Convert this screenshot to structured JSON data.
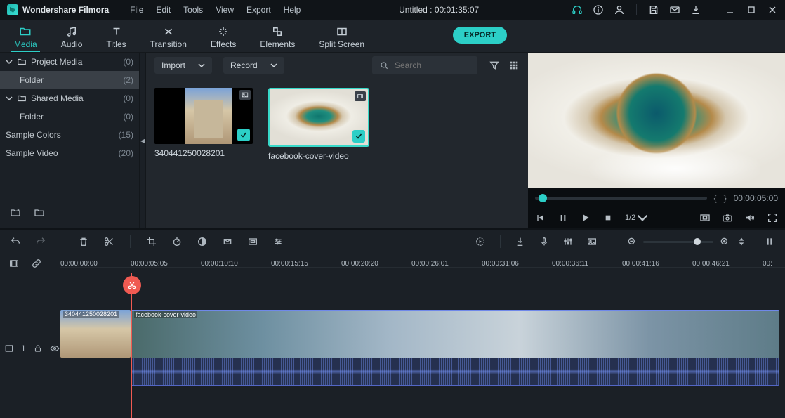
{
  "brand": "Wondershare Filmora",
  "menus": [
    "File",
    "Edit",
    "Tools",
    "View",
    "Export",
    "Help"
  ],
  "title": "Untitled : 00:01:35:07",
  "titlebar_icons": {
    "support": "headphones-icon",
    "info": "info-icon",
    "user": "user-icon",
    "save": "save-icon",
    "mail": "mail-icon",
    "download": "download-icon",
    "minimize": "minimize-icon",
    "maximize": "maximize-icon",
    "close": "close-icon"
  },
  "tabs": [
    {
      "id": "media",
      "label": "Media",
      "icon": "folder-icon",
      "active": true
    },
    {
      "id": "audio",
      "label": "Audio",
      "icon": "music-icon"
    },
    {
      "id": "titles",
      "label": "Titles",
      "icon": "text-icon"
    },
    {
      "id": "transition",
      "label": "Transition",
      "icon": "transition-icon"
    },
    {
      "id": "effects",
      "label": "Effects",
      "icon": "sparkle-icon"
    },
    {
      "id": "elements",
      "label": "Elements",
      "icon": "shapes-icon"
    },
    {
      "id": "split",
      "label": "Split Screen",
      "icon": "split-icon"
    }
  ],
  "export_label": "EXPORT",
  "sidebar": {
    "groups": [
      {
        "label": "Project Media",
        "count": "(0)",
        "expanded": true,
        "sub": [
          {
            "label": "Folder",
            "count": "(2)",
            "selected": true
          }
        ]
      },
      {
        "label": "Shared Media",
        "count": "(0)",
        "expanded": true,
        "sub": [
          {
            "label": "Folder",
            "count": "(0)"
          }
        ]
      }
    ],
    "bottom": [
      {
        "label": "Sample Colors",
        "count": "(15)"
      },
      {
        "label": "Sample Video",
        "count": "(20)"
      }
    ],
    "footer_icons": [
      "new-folder-icon",
      "folder-icon"
    ]
  },
  "media_toolbar": {
    "import": "Import",
    "record": "Record",
    "search_placeholder": "Search",
    "right_icons": [
      "filter-icon",
      "grid-icon"
    ]
  },
  "media_items": [
    {
      "caption": "340441250028201",
      "thumb": "street",
      "type": "image",
      "checked": true,
      "selected": false
    },
    {
      "caption": "facebook-cover-video",
      "thumb": "aerial",
      "type": "video",
      "checked": true,
      "selected": true
    }
  ],
  "preview": {
    "trim": {
      "open": "{",
      "close": "}"
    },
    "duration": "00:00:05:00",
    "rate": "1/2",
    "ctrl_icons": [
      "prev-icon",
      "pause-icon",
      "play-icon",
      "stop-icon"
    ],
    "right_icons": [
      "screenshot-icon",
      "camera-icon",
      "volume-icon",
      "fullscreen-icon"
    ]
  },
  "tl_tools": {
    "left": [
      "undo-icon",
      "redo-icon",
      "sep",
      "delete-icon",
      "cut-icon",
      "sep",
      "crop-icon",
      "speed-icon",
      "color-icon",
      "freeze-icon",
      "fit-icon",
      "adjust-icon"
    ],
    "right": [
      "render-icon",
      "sep",
      "marker-icon",
      "mic-icon",
      "mixer-icon",
      "picture-icon",
      "sep"
    ]
  },
  "ruler": {
    "link_icons": [
      "link-icon",
      "chain-icon"
    ],
    "ticks": [
      "00:00:00:00",
      "00:00:05:05",
      "00:00:10:10",
      "00:00:15:15",
      "00:00:20:20",
      "00:00:26:01",
      "00:00:31:06",
      "00:00:36:11",
      "00:00:41:16",
      "00:00:46:21",
      "00:"
    ]
  },
  "timeline_clips": {
    "clip1_label": "340441250028201",
    "clip2_label": "facebook-cover-video"
  },
  "track_head": {
    "label": "1",
    "icons": [
      "film-icon",
      "lock-icon",
      "eye-icon"
    ]
  },
  "colors": {
    "accent": "#2ccfc7",
    "playhead": "#f05a52"
  }
}
